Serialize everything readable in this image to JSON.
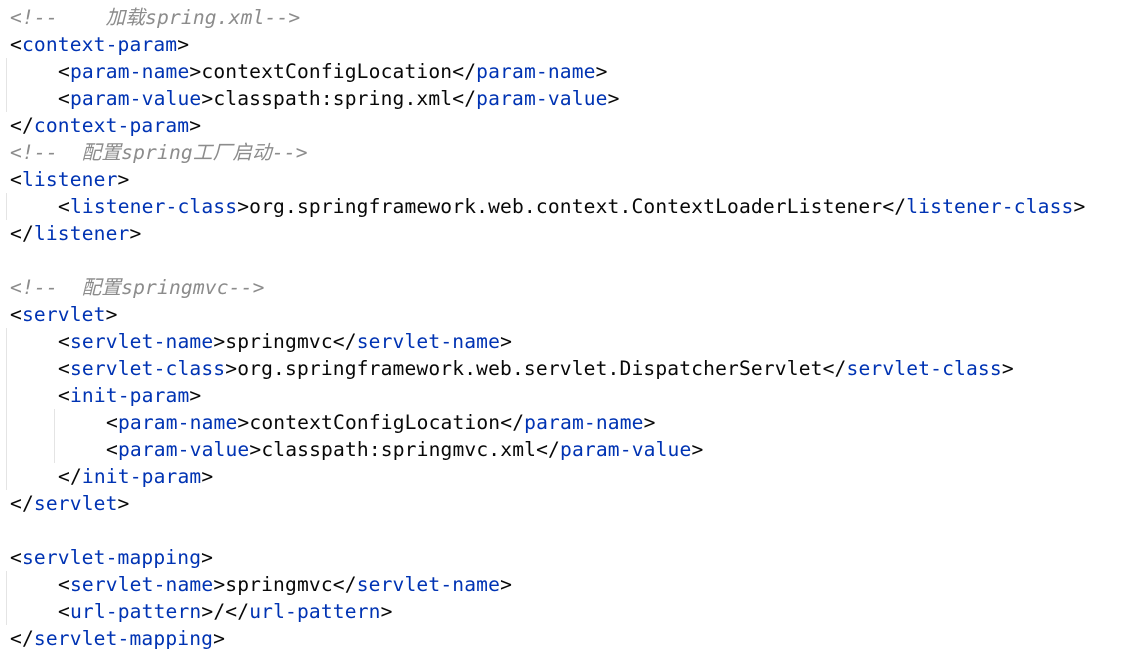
{
  "editor": {
    "lines": [
      {
        "indent": 0,
        "type": "comment",
        "text": "<!--    加载spring.xml-->"
      },
      {
        "indent": 0,
        "type": "open",
        "tag": "context-param"
      },
      {
        "indent": 1,
        "type": "element",
        "tag": "param-name",
        "value": "contextConfigLocation"
      },
      {
        "indent": 1,
        "type": "element",
        "tag": "param-value",
        "value": "classpath:spring.xml"
      },
      {
        "indent": 0,
        "type": "close",
        "tag": "context-param"
      },
      {
        "indent": 0,
        "type": "comment",
        "text": "<!--  配置spring工厂启动-->"
      },
      {
        "indent": 0,
        "type": "open",
        "tag": "listener"
      },
      {
        "indent": 1,
        "type": "element",
        "tag": "listener-class",
        "value": "org.springframework.web.context.ContextLoaderListener"
      },
      {
        "indent": 0,
        "type": "close",
        "tag": "listener"
      },
      {
        "indent": 0,
        "type": "blank"
      },
      {
        "indent": 0,
        "type": "comment",
        "text": "<!--  配置springmvc-->"
      },
      {
        "indent": 0,
        "type": "open",
        "tag": "servlet"
      },
      {
        "indent": 1,
        "type": "element",
        "tag": "servlet-name",
        "value": "springmvc"
      },
      {
        "indent": 1,
        "type": "element",
        "tag": "servlet-class",
        "value": "org.springframework.web.servlet.DispatcherServlet"
      },
      {
        "indent": 1,
        "type": "open",
        "tag": "init-param"
      },
      {
        "indent": 2,
        "type": "element",
        "tag": "param-name",
        "value": "contextConfigLocation"
      },
      {
        "indent": 2,
        "type": "element",
        "tag": "param-value",
        "value": "classpath:springmvc.xml"
      },
      {
        "indent": 1,
        "type": "close",
        "tag": "init-param"
      },
      {
        "indent": 0,
        "type": "close",
        "tag": "servlet"
      },
      {
        "indent": 0,
        "type": "blank"
      },
      {
        "indent": 0,
        "type": "open",
        "tag": "servlet-mapping"
      },
      {
        "indent": 1,
        "type": "element",
        "tag": "servlet-name",
        "value": "springmvc"
      },
      {
        "indent": 1,
        "type": "element",
        "tag": "url-pattern",
        "value": "/"
      },
      {
        "indent": 0,
        "type": "close",
        "tag": "servlet-mapping"
      }
    ]
  },
  "colors": {
    "background": "#ffffff",
    "tag": "#0033b3",
    "text": "#080808",
    "comment": "#8c8c8c",
    "indent_guide": "#e4e4e4"
  }
}
